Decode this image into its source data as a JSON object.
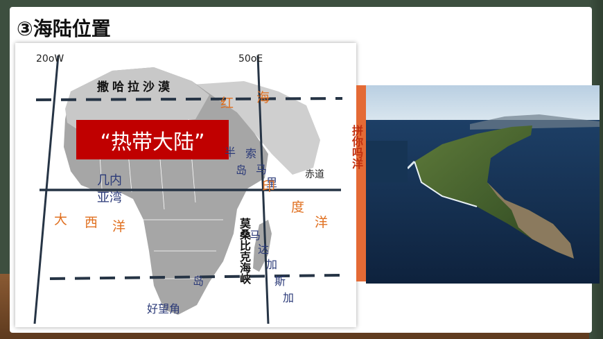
{
  "title": "③海陆位置",
  "map": {
    "lon_west": "20oW",
    "lon_east": "50oE",
    "desert": "撒哈拉沙漠",
    "tropical_continent": "“热带大陆”",
    "red_sea_1": "红",
    "red_sea_2": "海",
    "peninsula": [
      "半",
      "岛",
      "马",
      "里",
      "索"
    ],
    "equator": "赤道",
    "guinea_bay": [
      "几内",
      "亚湾"
    ],
    "atlantic": [
      "大",
      "西",
      "洋"
    ],
    "indian_ocean": [
      "印",
      "度",
      "洋"
    ],
    "mozambique_channel": "莫桑比克海峡",
    "madagascar": [
      "马",
      "达",
      "加",
      "斯",
      "加",
      "岛"
    ],
    "cape": "好望角"
  },
  "strip_text": "拼你吗洋"
}
